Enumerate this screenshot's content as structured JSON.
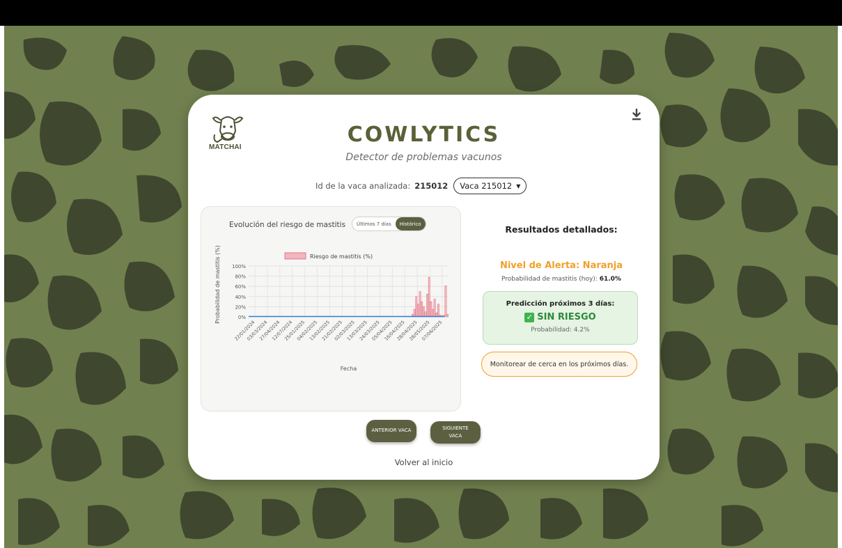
{
  "app": {
    "logo_text": "MATCHAI",
    "title": "COWLYTICS",
    "subtitle": "Detector de problemas vacunos"
  },
  "cow": {
    "id_label": "Id de la vaca analizada:",
    "id_value": "215012",
    "selector_value": "Vaca 215012"
  },
  "chart_panel": {
    "heading": "Evolución del riesgo de mastitis",
    "toggle_options": [
      "Últimos 7 días",
      "Histórico"
    ],
    "active_toggle": "Histórico"
  },
  "chart_data": {
    "type": "bar",
    "title": "",
    "xlabel": "Fecha",
    "ylabel": "Probabilidad de mastitis (%)",
    "ylim": [
      0,
      100
    ],
    "yticks": [
      "0%",
      "20%",
      "40%",
      "60%",
      "80%",
      "100%"
    ],
    "legend": "Riesgo de mastitis (%)",
    "legend_placement": "top-center",
    "grid": true,
    "colors": {
      "bar": "#f2b6c0",
      "bar_edge": "#d9616f",
      "line": "#2f7fd6"
    },
    "x_tick_labels": [
      "22/01/2024",
      "03/03/2024",
      "27/04/2024",
      "12/07/2024",
      "25/01/2025",
      "04/02/2025",
      "13/02/2025",
      "21/02/2025",
      "02/03/2025",
      "13/03/2025",
      "24/03/2025",
      "05/04/2025",
      "16/04/2025",
      "28/04/2025",
      "28/05/2025",
      "07/06/2025"
    ],
    "series": [
      {
        "name": "Riesgo de mastitis (%)",
        "values": [
          0,
          0,
          0,
          0,
          0,
          0,
          0,
          0,
          0,
          1,
          0,
          0,
          0,
          0,
          0,
          0,
          0,
          0,
          0,
          0,
          0,
          0,
          0,
          0,
          0,
          0,
          0,
          0,
          0,
          0,
          0,
          0,
          0,
          0,
          0,
          0,
          0,
          0,
          0,
          0,
          0,
          0,
          0,
          0,
          0,
          0,
          1,
          0,
          0,
          0,
          0,
          0,
          0,
          0,
          0,
          0,
          0,
          0,
          0,
          0,
          0,
          0,
          0,
          0,
          0,
          0,
          0,
          0,
          0,
          0,
          0,
          0,
          0,
          1,
          0,
          0,
          0,
          0,
          0,
          0,
          0,
          0,
          0,
          0,
          0,
          0,
          0,
          0,
          0,
          5,
          15,
          40,
          25,
          50,
          30,
          20,
          10,
          45,
          78,
          30,
          15,
          35,
          8,
          25,
          4,
          2,
          3,
          61,
          5
        ]
      }
    ]
  },
  "results": {
    "title": "Resultados detallados:",
    "alert": "Nivel de Alerta: Naranja",
    "prob_today_label": "Probabilidad de mastitis (hoy):",
    "prob_today_value": "61.0%",
    "prediction_title": "Predicción próximos 3 días:",
    "prediction_status": "SIN RIESGO",
    "prediction_prob": "Probabilidad: 4.2%",
    "recommendation": "Monitorear de cerca en los próximos días."
  },
  "nav": {
    "prev_label": "ANTERIOR VACA",
    "next_label": "SIGUIENTE VACA",
    "home_link": "Volver al inicio"
  },
  "icons": {
    "download": "download-icon",
    "caret": "chevron-down-icon",
    "check": "check-icon",
    "logo": "cow-logo-icon"
  },
  "colors": {
    "background": "#71804f",
    "spots": "#40472f",
    "brand": "#5c6041",
    "alert_orange": "#f0a02a",
    "safe_green": "#2e8a3a"
  }
}
